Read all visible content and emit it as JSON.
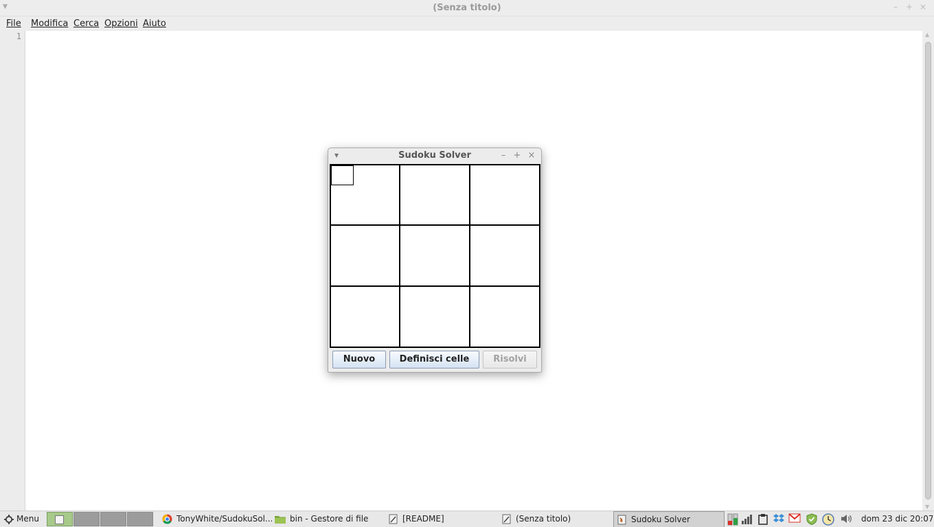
{
  "editor": {
    "window_title": "(Senza titolo)",
    "menu": [
      "File",
      "Modifica",
      "Cerca",
      "Opzioni",
      "Aiuto"
    ],
    "line_number": "1"
  },
  "sudoku": {
    "title": "Sudoku Solver",
    "buttons": {
      "new": "Nuovo",
      "define": "Definisci celle",
      "solve": "Risolvi"
    }
  },
  "taskbar": {
    "menu_label": "Menu",
    "tasks": [
      "TonyWhite/SudokuSol...",
      "bin - Gestore di file",
      "[README]",
      "(Senza titolo)",
      "Sudoku Solver"
    ],
    "clock": "dom 23 dic 20:07"
  },
  "colors": {
    "button_accent": "#d5e3f3",
    "active_workspace": "#a7c98a",
    "gmail_red": "#d93025"
  },
  "icons": [
    "gear-icon",
    "chrome-icon",
    "folder-icon",
    "text-editor-icon",
    "java-icon",
    "network-icon",
    "signal-icon",
    "clipboard-icon",
    "dropbox-icon",
    "gmail-icon",
    "shield-icon",
    "clock-icon",
    "volume-icon"
  ]
}
